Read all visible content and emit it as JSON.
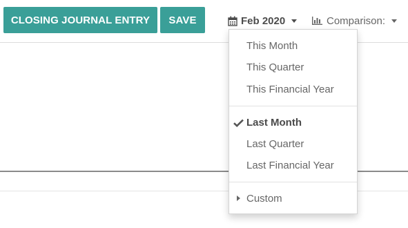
{
  "toolbar": {
    "closing_label": "CLOSING JOURNAL ENTRY",
    "save_label": "SAVE"
  },
  "filters": {
    "date": {
      "icon": "calendar-icon",
      "label": "Feb 2020"
    },
    "comparison": {
      "icon": "bar-chart-icon",
      "label": "Comparison:"
    }
  },
  "date_menu": {
    "groups": [
      {
        "items": [
          {
            "label": "This Month"
          },
          {
            "label": "This Quarter"
          },
          {
            "label": "This Financial Year"
          }
        ]
      },
      {
        "items": [
          {
            "label": "Last Month",
            "selected": true
          },
          {
            "label": "Last Quarter"
          },
          {
            "label": "Last Financial Year"
          }
        ]
      },
      {
        "items": [
          {
            "label": "Custom",
            "expandable": true
          }
        ]
      }
    ]
  },
  "colors": {
    "button_bg": "#3a9f98",
    "button_text": "#ffffff",
    "menu_text": "#666666",
    "selected_text": "#4a4a4a"
  }
}
